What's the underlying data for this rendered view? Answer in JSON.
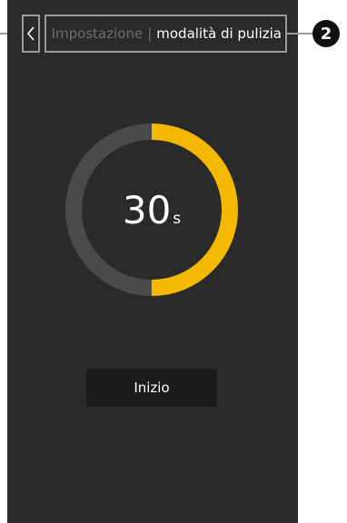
{
  "header": {
    "breadcrumb_previous": "Impostazione",
    "breadcrumb_separator": "|",
    "breadcrumb_current": "modalità di pulizia"
  },
  "callout": {
    "number": "2"
  },
  "timer": {
    "value": "30",
    "unit": "s",
    "progress": 0.5
  },
  "start_button_label": "Inizio",
  "colors": {
    "screen_background": "#2a2a2a",
    "ring_track": "#4a4a4a",
    "ring_progress": "#f5b800",
    "highlight_box": "#9a9a9a"
  }
}
